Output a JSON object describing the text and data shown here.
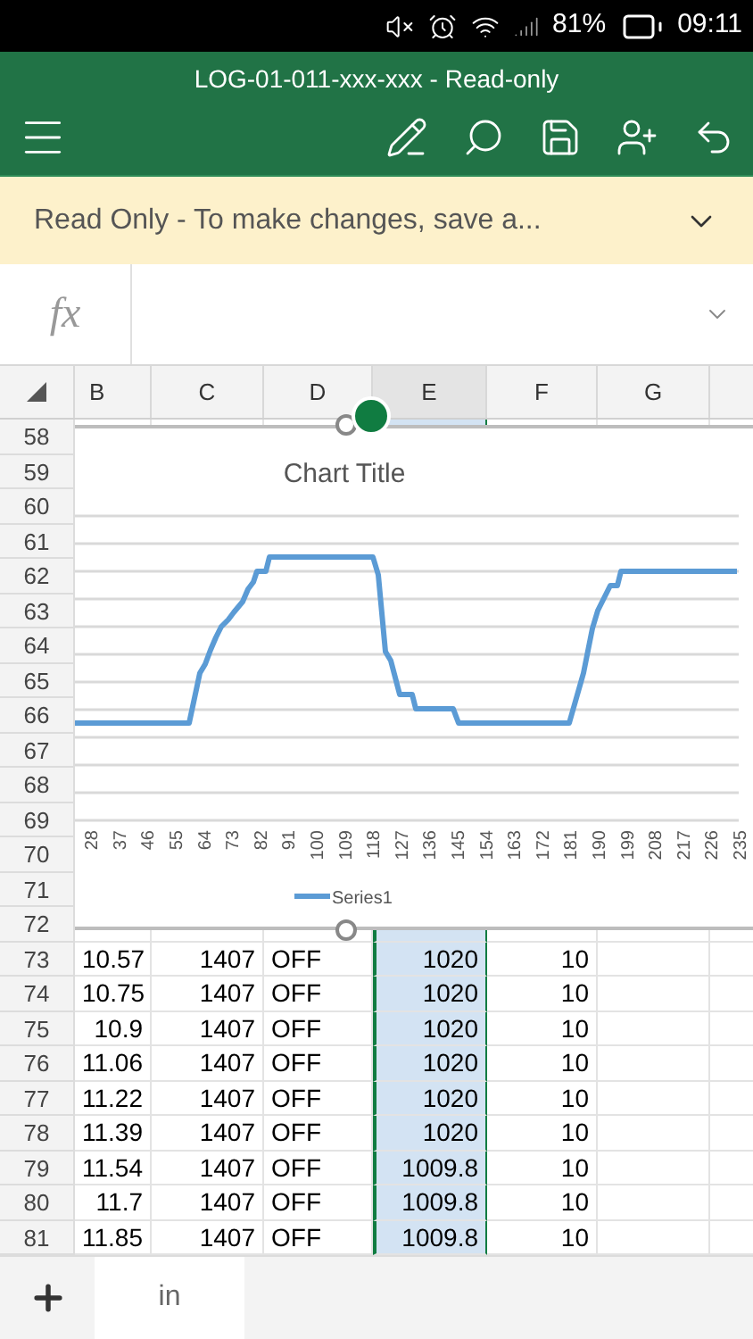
{
  "status_bar": {
    "battery": "81%",
    "time": "09:11"
  },
  "window": {
    "title": "LOG-01-011-xxx-xxx - Read-only"
  },
  "notice": {
    "text": "Read Only - To make changes, save a..."
  },
  "formula_bar": {
    "label": "fx"
  },
  "columns": [
    {
      "label": "B",
      "selected": false
    },
    {
      "label": "C",
      "selected": false
    },
    {
      "label": "D",
      "selected": false
    },
    {
      "label": "E",
      "selected": true
    },
    {
      "label": "F",
      "selected": false
    },
    {
      "label": "G",
      "selected": false
    }
  ],
  "chart_rows": [
    "58",
    "59",
    "60",
    "61",
    "62",
    "63",
    "64",
    "65",
    "66",
    "67",
    "68",
    "69",
    "70",
    "71",
    "72"
  ],
  "chart": {
    "title": "Chart Title",
    "x_labels": [
      "28",
      "37",
      "46",
      "55",
      "64",
      "73",
      "82",
      "91",
      "100",
      "109",
      "118",
      "127",
      "136",
      "145",
      "154",
      "163",
      "172",
      "181",
      "190",
      "199",
      "208",
      "217",
      "226",
      "235"
    ],
    "legend": "Series1"
  },
  "rows": [
    {
      "number": "73",
      "cells": [
        "10.57",
        "1407",
        "OFF",
        "1020",
        "10"
      ]
    },
    {
      "number": "74",
      "cells": [
        "10.75",
        "1407",
        "OFF",
        "1020",
        "10"
      ]
    },
    {
      "number": "75",
      "cells": [
        "10.9",
        "1407",
        "OFF",
        "1020",
        "10"
      ]
    },
    {
      "number": "76",
      "cells": [
        "11.06",
        "1407",
        "OFF",
        "1020",
        "10"
      ]
    },
    {
      "number": "77",
      "cells": [
        "11.22",
        "1407",
        "OFF",
        "1020",
        "10"
      ]
    },
    {
      "number": "78",
      "cells": [
        "11.39",
        "1407",
        "OFF",
        "1020",
        "10"
      ]
    },
    {
      "number": "79",
      "cells": [
        "11.54",
        "1407",
        "OFF",
        "1009.8",
        "10"
      ]
    },
    {
      "number": "80",
      "cells": [
        "11.7",
        "1407",
        "OFF",
        "1009.8",
        "10"
      ]
    },
    {
      "number": "81",
      "cells": [
        "11.85",
        "1407",
        "OFF",
        "1009.8",
        "10"
      ]
    }
  ],
  "sheets": [
    {
      "label": "in",
      "selected": true
    }
  ]
}
